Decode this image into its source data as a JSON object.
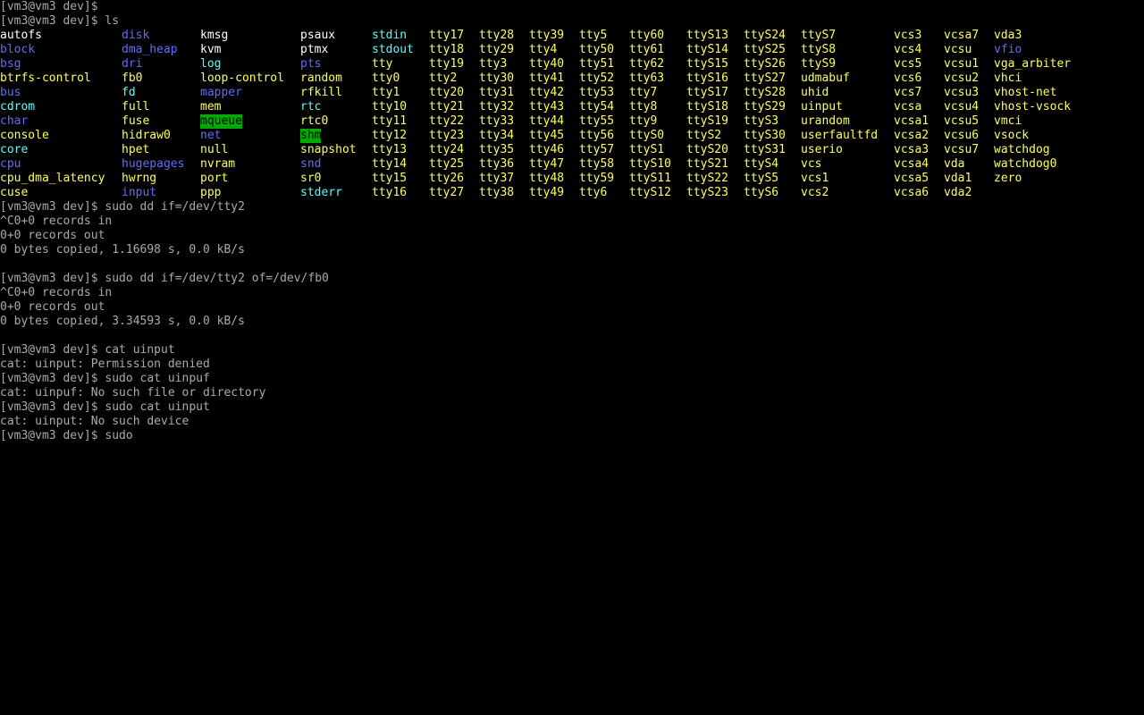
{
  "colors": {
    "background": "#000000",
    "text": "#aaaaaa",
    "regular": "#ffffff",
    "directory": "#5f6bff",
    "symlink": "#55ffff",
    "device": "#ffff55",
    "sticky_bg": "#00aa00"
  },
  "lines_before": [
    "[vm3@vm3 dev]$",
    "[vm3@vm3 dev]$ ls"
  ],
  "ls_listing": {
    "rows": [
      [
        [
          "autofs",
          "reg"
        ],
        [
          "disk",
          "dir"
        ],
        [
          "kmsg",
          "reg"
        ],
        [
          "psaux",
          "reg"
        ],
        [
          "stdin",
          "link"
        ],
        [
          "tty17",
          "dev"
        ],
        [
          "tty28",
          "dev"
        ],
        [
          "tty39",
          "dev"
        ],
        [
          "tty5",
          "dev"
        ],
        [
          "tty60",
          "dev"
        ],
        [
          "ttyS13",
          "dev"
        ],
        [
          "ttyS24",
          "dev"
        ],
        [
          "ttyS7",
          "dev"
        ],
        [
          "vcs3",
          "dev"
        ],
        [
          "vcsa7",
          "dev"
        ],
        [
          "vda3",
          "dev"
        ]
      ],
      [
        [
          "block",
          "dir"
        ],
        [
          "dma_heap",
          "dir"
        ],
        [
          "kvm",
          "reg"
        ],
        [
          "ptmx",
          "reg"
        ],
        [
          "stdout",
          "link"
        ],
        [
          "tty18",
          "dev"
        ],
        [
          "tty29",
          "dev"
        ],
        [
          "tty4",
          "dev"
        ],
        [
          "tty50",
          "dev"
        ],
        [
          "tty61",
          "dev"
        ],
        [
          "ttyS14",
          "dev"
        ],
        [
          "ttyS25",
          "dev"
        ],
        [
          "ttyS8",
          "dev"
        ],
        [
          "vcs4",
          "dev"
        ],
        [
          "vcsu",
          "dev"
        ],
        [
          "vfio",
          "dir"
        ]
      ],
      [
        [
          "bsg",
          "dir"
        ],
        [
          "dri",
          "dir"
        ],
        [
          "log",
          "link"
        ],
        [
          "pts",
          "dir"
        ],
        [
          "tty",
          "dev"
        ],
        [
          "tty19",
          "dev"
        ],
        [
          "tty3",
          "dev"
        ],
        [
          "tty40",
          "dev"
        ],
        [
          "tty51",
          "dev"
        ],
        [
          "tty62",
          "dev"
        ],
        [
          "ttyS15",
          "dev"
        ],
        [
          "ttyS26",
          "dev"
        ],
        [
          "ttyS9",
          "dev"
        ],
        [
          "vcs5",
          "dev"
        ],
        [
          "vcsu1",
          "dev"
        ],
        [
          "vga_arbiter",
          "dev"
        ]
      ],
      [
        [
          "btrfs-control",
          "dev"
        ],
        [
          "fb0",
          "dev"
        ],
        [
          "loop-control",
          "dev"
        ],
        [
          "random",
          "dev"
        ],
        [
          "tty0",
          "dev"
        ],
        [
          "tty2",
          "dev"
        ],
        [
          "tty30",
          "dev"
        ],
        [
          "tty41",
          "dev"
        ],
        [
          "tty52",
          "dev"
        ],
        [
          "tty63",
          "dev"
        ],
        [
          "ttyS16",
          "dev"
        ],
        [
          "ttyS27",
          "dev"
        ],
        [
          "udmabuf",
          "dev"
        ],
        [
          "vcs6",
          "dev"
        ],
        [
          "vcsu2",
          "dev"
        ],
        [
          "vhci",
          "dev"
        ]
      ],
      [
        [
          "bus",
          "dir"
        ],
        [
          "fd",
          "link"
        ],
        [
          "mapper",
          "dir"
        ],
        [
          "rfkill",
          "dev"
        ],
        [
          "tty1",
          "dev"
        ],
        [
          "tty20",
          "dev"
        ],
        [
          "tty31",
          "dev"
        ],
        [
          "tty42",
          "dev"
        ],
        [
          "tty53",
          "dev"
        ],
        [
          "tty7",
          "dev"
        ],
        [
          "ttyS17",
          "dev"
        ],
        [
          "ttyS28",
          "dev"
        ],
        [
          "uhid",
          "dev"
        ],
        [
          "vcs7",
          "dev"
        ],
        [
          "vcsu3",
          "dev"
        ],
        [
          "vhost-net",
          "dev"
        ]
      ],
      [
        [
          "cdrom",
          "link"
        ],
        [
          "full",
          "dev"
        ],
        [
          "mem",
          "dev"
        ],
        [
          "rtc",
          "link"
        ],
        [
          "tty10",
          "dev"
        ],
        [
          "tty21",
          "dev"
        ],
        [
          "tty32",
          "dev"
        ],
        [
          "tty43",
          "dev"
        ],
        [
          "tty54",
          "dev"
        ],
        [
          "tty8",
          "dev"
        ],
        [
          "ttyS18",
          "dev"
        ],
        [
          "ttyS29",
          "dev"
        ],
        [
          "uinput",
          "dev"
        ],
        [
          "vcsa",
          "dev"
        ],
        [
          "vcsu4",
          "dev"
        ],
        [
          "vhost-vsock",
          "dev"
        ]
      ],
      [
        [
          "char",
          "dir"
        ],
        [
          "fuse",
          "dev"
        ],
        [
          "mqueue",
          "sticky"
        ],
        [
          "rtc0",
          "dev"
        ],
        [
          "tty11",
          "dev"
        ],
        [
          "tty22",
          "dev"
        ],
        [
          "tty33",
          "dev"
        ],
        [
          "tty44",
          "dev"
        ],
        [
          "tty55",
          "dev"
        ],
        [
          "tty9",
          "dev"
        ],
        [
          "ttyS19",
          "dev"
        ],
        [
          "ttyS3",
          "dev"
        ],
        [
          "urandom",
          "dev"
        ],
        [
          "vcsa1",
          "dev"
        ],
        [
          "vcsu5",
          "dev"
        ],
        [
          "vmci",
          "dev"
        ]
      ],
      [
        [
          "console",
          "dev"
        ],
        [
          "hidraw0",
          "dev"
        ],
        [
          "net",
          "dir"
        ],
        [
          "shm",
          "sticky"
        ],
        [
          "tty12",
          "dev"
        ],
        [
          "tty23",
          "dev"
        ],
        [
          "tty34",
          "dev"
        ],
        [
          "tty45",
          "dev"
        ],
        [
          "tty56",
          "dev"
        ],
        [
          "ttyS0",
          "dev"
        ],
        [
          "ttyS2",
          "dev"
        ],
        [
          "ttyS30",
          "dev"
        ],
        [
          "userfaultfd",
          "dev"
        ],
        [
          "vcsa2",
          "dev"
        ],
        [
          "vcsu6",
          "dev"
        ],
        [
          "vsock",
          "dev"
        ]
      ],
      [
        [
          "core",
          "link"
        ],
        [
          "hpet",
          "dev"
        ],
        [
          "null",
          "dev"
        ],
        [
          "snapshot",
          "dev"
        ],
        [
          "tty13",
          "dev"
        ],
        [
          "tty24",
          "dev"
        ],
        [
          "tty35",
          "dev"
        ],
        [
          "tty46",
          "dev"
        ],
        [
          "tty57",
          "dev"
        ],
        [
          "ttyS1",
          "dev"
        ],
        [
          "ttyS20",
          "dev"
        ],
        [
          "ttyS31",
          "dev"
        ],
        [
          "userio",
          "dev"
        ],
        [
          "vcsa3",
          "dev"
        ],
        [
          "vcsu7",
          "dev"
        ],
        [
          "watchdog",
          "dev"
        ]
      ],
      [
        [
          "cpu",
          "dir"
        ],
        [
          "hugepages",
          "dir"
        ],
        [
          "nvram",
          "dev"
        ],
        [
          "snd",
          "dir"
        ],
        [
          "tty14",
          "dev"
        ],
        [
          "tty25",
          "dev"
        ],
        [
          "tty36",
          "dev"
        ],
        [
          "tty47",
          "dev"
        ],
        [
          "tty58",
          "dev"
        ],
        [
          "ttyS10",
          "dev"
        ],
        [
          "ttyS21",
          "dev"
        ],
        [
          "ttyS4",
          "dev"
        ],
        [
          "vcs",
          "dev"
        ],
        [
          "vcsa4",
          "dev"
        ],
        [
          "vda",
          "dev"
        ],
        [
          "watchdog0",
          "dev"
        ]
      ],
      [
        [
          "cpu_dma_latency",
          "dev"
        ],
        [
          "hwrng",
          "dev"
        ],
        [
          "port",
          "dev"
        ],
        [
          "sr0",
          "dev"
        ],
        [
          "tty15",
          "dev"
        ],
        [
          "tty26",
          "dev"
        ],
        [
          "tty37",
          "dev"
        ],
        [
          "tty48",
          "dev"
        ],
        [
          "tty59",
          "dev"
        ],
        [
          "ttyS11",
          "dev"
        ],
        [
          "ttyS22",
          "dev"
        ],
        [
          "ttyS5",
          "dev"
        ],
        [
          "vcs1",
          "dev"
        ],
        [
          "vcsa5",
          "dev"
        ],
        [
          "vda1",
          "dev"
        ],
        [
          "zero",
          "dev"
        ]
      ],
      [
        [
          "cuse",
          "dev"
        ],
        [
          "input",
          "dir"
        ],
        [
          "ppp",
          "dev"
        ],
        [
          "stderr",
          "link"
        ],
        [
          "tty16",
          "dev"
        ],
        [
          "tty27",
          "dev"
        ],
        [
          "tty38",
          "dev"
        ],
        [
          "tty49",
          "dev"
        ],
        [
          "tty6",
          "dev"
        ],
        [
          "ttyS12",
          "dev"
        ],
        [
          "ttyS23",
          "dev"
        ],
        [
          "ttyS6",
          "dev"
        ],
        [
          "vcs2",
          "dev"
        ],
        [
          "vcsa6",
          "dev"
        ],
        [
          "vda2",
          "dev"
        ]
      ]
    ]
  },
  "lines_after": [
    "[vm3@vm3 dev]$ sudo dd if=/dev/tty2",
    "^C0+0 records in",
    "0+0 records out",
    "0 bytes copied, 1.16698 s, 0.0 kB/s",
    "",
    "[vm3@vm3 dev]$ sudo dd if=/dev/tty2 of=/dev/fb0",
    "^C0+0 records in",
    "0+0 records out",
    "0 bytes copied, 3.34593 s, 0.0 kB/s",
    "",
    "[vm3@vm3 dev]$ cat uinput",
    "cat: uinput: Permission denied",
    "[vm3@vm3 dev]$ sudo cat uinpuf",
    "cat: uinpuf: No such file or directory",
    "[vm3@vm3 dev]$ sudo cat uinput",
    "cat: uinput: No such device",
    "[vm3@vm3 dev]$ sudo"
  ]
}
